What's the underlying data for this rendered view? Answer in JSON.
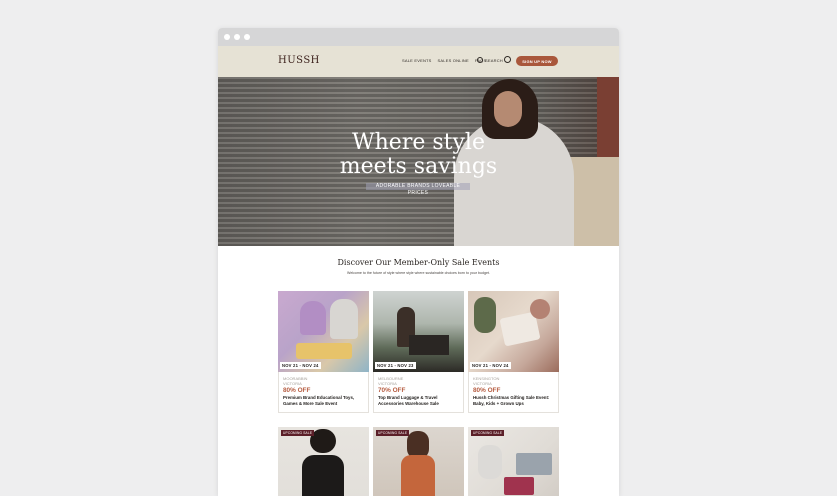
{
  "brand": {
    "logo": "HUSSH",
    "accent": "#a9573b"
  },
  "nav": {
    "links": [
      "SALE EVENTS",
      "SALES ONLINE",
      "FAQS"
    ],
    "search_label": "SEARCH",
    "signup_label": "SIGN UP NOW"
  },
  "hero": {
    "title_line1": "Where style",
    "title_line2": "meets savings",
    "subtitle": "ADORABLE BRANDS LOVEABLE PRICES"
  },
  "section": {
    "title": "Discover Our Member-Only Sale Events",
    "subtitle": "Welcome to the future of style where style where sustainable choices born to your budget."
  },
  "events": [
    {
      "date": "NOV 21 - NOV 24",
      "suburb": "MOORABBIN",
      "state": "VICTORIA",
      "discount": "80% OFF",
      "description": "Premium Brand Educational Toys, Games & More Sale Event"
    },
    {
      "date": "NOV 21 - NOV 23",
      "suburb": "MELBOURNE",
      "state": "VICTORIA",
      "discount": "70% OFF",
      "description": "Top Brand Luggage & Travel Accessories Warehouse Sale"
    },
    {
      "date": "NOV 21 - NOV 24",
      "suburb": "KENSINGTON",
      "state": "VICTORIA",
      "discount": "80% OFF",
      "description": "Hussh Christmas Gifting Sale Event: Baby, Kids + Grown Ups"
    }
  ],
  "upcoming": [
    {
      "badge": "UPCOMING SALE"
    },
    {
      "badge": "UPCOMING SALE"
    },
    {
      "badge": "UPCOMING SALE"
    }
  ]
}
